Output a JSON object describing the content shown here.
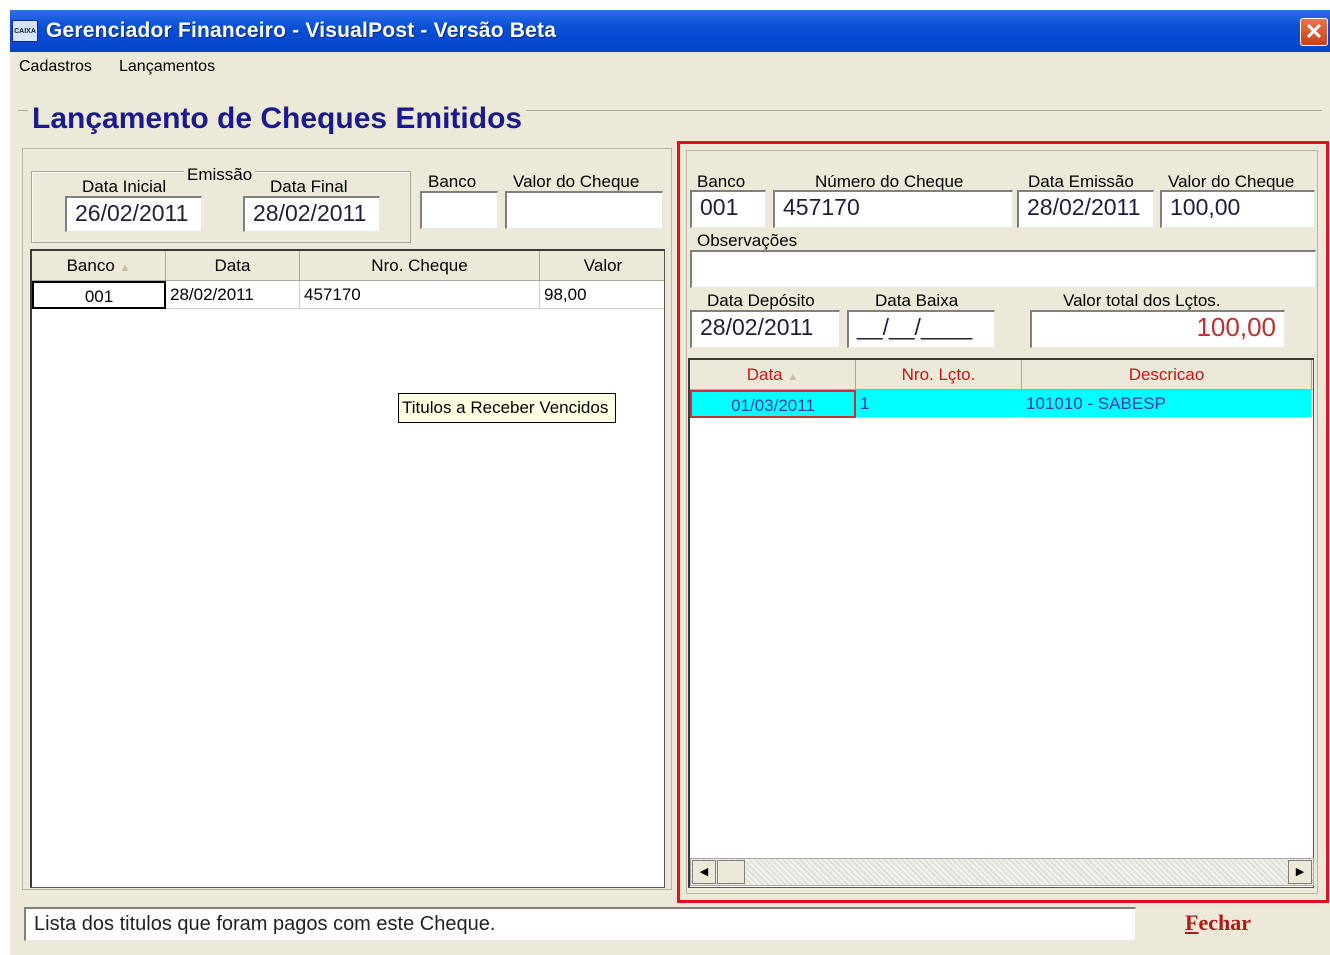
{
  "window": {
    "title": "Gerenciador Financeiro - VisualPost - Versão Beta",
    "icon_text": "CAIXA",
    "close_glyph": "✕"
  },
  "menu": {
    "items": [
      "Cadastros",
      "Lançamentos"
    ]
  },
  "page": {
    "title": "Lançamento de Cheques Emitidos"
  },
  "filters": {
    "emissao_label": "Emissão",
    "data_inicial_label": "Data Inicial",
    "data_inicial_value": "26/02/2011",
    "data_final_label": "Data Final",
    "data_final_value": "28/02/2011",
    "banco_label": "Banco",
    "banco_value": "",
    "valor_label": "Valor do Cheque",
    "valor_value": ""
  },
  "cheques_grid": {
    "columns": [
      "Banco",
      "Data",
      "Nro. Cheque",
      "Valor"
    ],
    "rows": [
      {
        "banco": "001",
        "data": "28/02/2011",
        "nro": "457170",
        "valor": "98,00"
      }
    ]
  },
  "tooltip": "Titulos a Receber Vencidos",
  "detail": {
    "banco_label": "Banco",
    "banco_value": "001",
    "numero_label": "Número do Cheque",
    "numero_value": "457170",
    "data_emissao_label": "Data Emissão",
    "data_emissao_value": "28/02/2011",
    "valor_label": "Valor do Cheque",
    "valor_value": "100,00",
    "obs_label": "Observações",
    "obs_value": "",
    "data_deposito_label": "Data Depósito",
    "data_deposito_value": "28/02/2011",
    "data_baixa_label": "Data Baixa",
    "data_baixa_value": "__/__/____",
    "total_label": "Valor total dos Lçtos.",
    "total_value": "100,00"
  },
  "lancamentos_grid": {
    "columns": [
      "Data",
      "Nro. Lçto.",
      "Descricao"
    ],
    "rows": [
      {
        "data": "01/03/2011",
        "nro": "1",
        "descricao": "101010 - SABESP"
      }
    ]
  },
  "status": {
    "text": "Lista dos titulos que foram pagos com este Cheque."
  },
  "buttons": {
    "fechar_first": "F",
    "fechar_rest": "echar"
  },
  "colors": {
    "highlight": "#e0141e",
    "row_selected": "#00ffff",
    "header_text_red": "#c81414",
    "title_blue": "#1a1a8c"
  }
}
